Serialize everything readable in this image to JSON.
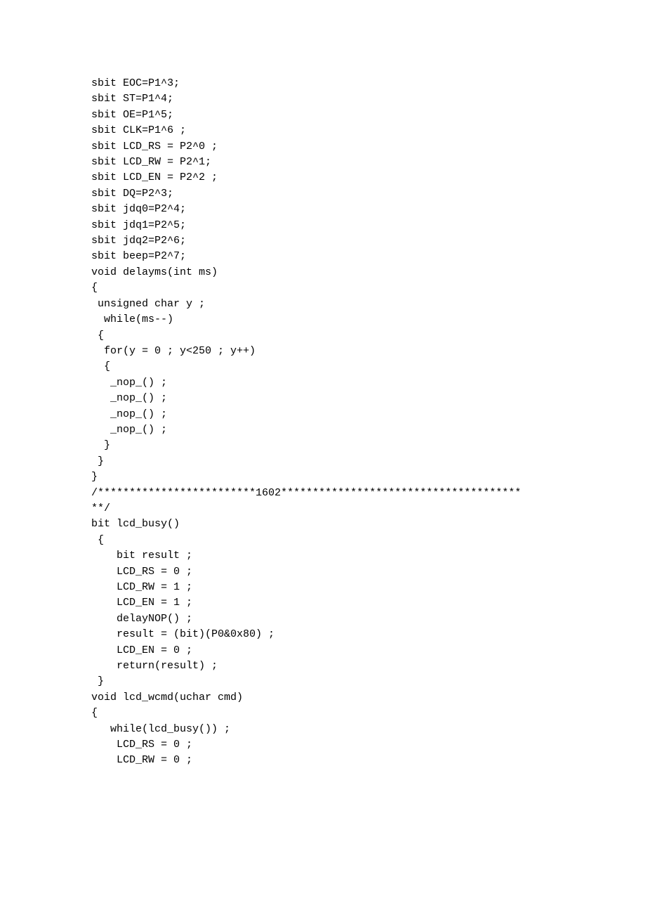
{
  "code": {
    "lines": [
      "sbit EOC=P1^3;",
      "sbit ST=P1^4;",
      "sbit OE=P1^5;",
      "sbit CLK=P1^6 ;",
      "sbit LCD_RS = P2^0 ;",
      "sbit LCD_RW = P2^1;",
      "sbit LCD_EN = P2^2 ;",
      "sbit DQ=P2^3;",
      "sbit jdq0=P2^4;",
      "sbit jdq1=P2^5;",
      "sbit jdq2=P2^6;",
      "sbit beep=P2^7;",
      "void delayms(int ms)",
      "{",
      " unsigned char y ;",
      "  while(ms--)",
      " {",
      "  for(y = 0 ; y<250 ; y++)",
      "  {",
      "   _nop_() ;",
      "   _nop_() ;",
      "   _nop_() ;",
      "   _nop_() ;",
      "  }",
      " }",
      "}",
      "/*************************1602**************************************",
      "**/",
      "bit lcd_busy()",
      " {",
      "    bit result ;",
      "    LCD_RS = 0 ;",
      "    LCD_RW = 1 ;",
      "    LCD_EN = 1 ;",
      "    delayNOP() ;",
      "    result = (bit)(P0&0x80) ;",
      "    LCD_EN = 0 ;",
      "    return(result) ;",
      " }",
      "void lcd_wcmd(uchar cmd)",
      "{",
      "   while(lcd_busy()) ;",
      "    LCD_RS = 0 ;",
      "    LCD_RW = 0 ;"
    ]
  }
}
